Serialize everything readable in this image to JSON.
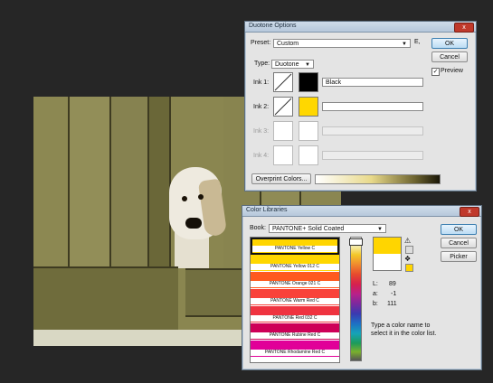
{
  "duotone": {
    "title": "Duotone Options",
    "close": "x",
    "preset_label": "Preset:",
    "preset_value": "Custom",
    "preset_menu": "E,",
    "type_label": "Type:",
    "type_value": "Duotone",
    "inks": [
      {
        "label": "Ink 1:",
        "name": "Black",
        "color": "#000000"
      },
      {
        "label": "Ink 2:",
        "name": "",
        "color": "#ffd700"
      },
      {
        "label": "Ink 3:",
        "name": "",
        "color": "#ffffff"
      },
      {
        "label": "Ink 4:",
        "name": "",
        "color": "#ffffff"
      }
    ],
    "overprint_button": "Overprint Colors...",
    "ok_button": "OK",
    "cancel_button": "Cancel",
    "preview_label": "Preview",
    "preview_checked": true
  },
  "libraries": {
    "title": "Color Libraries",
    "close": "x",
    "book_label": "Book:",
    "book_value": "PANTONE+ Solid Coated",
    "colors": [
      {
        "name": "PANTONE Yellow C",
        "hex": "#ffd500"
      },
      {
        "name": "PANTONE Yellow 012 C",
        "hex": "#ffd700"
      },
      {
        "name": "PANTONE Orange 021 C",
        "hex": "#ff5a1f"
      },
      {
        "name": "PANTONE Warm Red C",
        "hex": "#f9423a"
      },
      {
        "name": "PANTONE Red 032 C",
        "hex": "#ef3340"
      },
      {
        "name": "PANTONE Rubine Red C",
        "hex": "#ce0058"
      },
      {
        "name": "PANTONE Rhodamine Red C",
        "hex": "#e10098"
      }
    ],
    "l_label": "L:",
    "l_value": "89",
    "a_label": "a:",
    "a_value": "-1",
    "b_label": "b:",
    "b_value": "111",
    "hint": "Type a color name to select it in the color list.",
    "ok_button": "OK",
    "cancel_button": "Cancel",
    "picker_button": "Picker",
    "selected_color": "#ffd500",
    "original_color": "#ffffff"
  }
}
